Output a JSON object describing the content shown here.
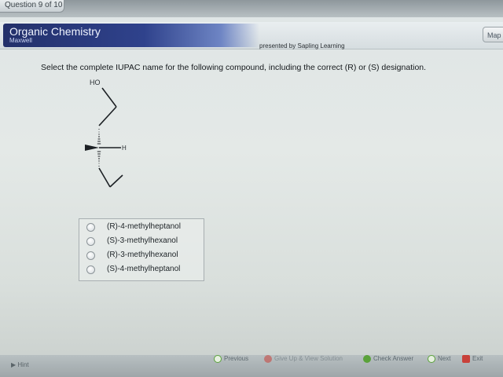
{
  "window": {
    "question_tab": "Question 9 of 10"
  },
  "brand": {
    "title": "Organic Chemistry",
    "subtitle": "Maxwell"
  },
  "header": {
    "presented_by": "presented by Sapling Learning",
    "map_label": "Map"
  },
  "question": {
    "text": "Select the complete IUPAC name for the following compound, including the correct (R) or (S) designation.",
    "molecule_labels": {
      "oh": "HO",
      "h": "H"
    }
  },
  "choices": [
    {
      "label": "(R)-4-methylheptanol",
      "selected": false
    },
    {
      "label": "(S)-3-methylhexanol",
      "selected": false
    },
    {
      "label": "(R)-3-methylhexanol",
      "selected": false
    },
    {
      "label": "(S)-4-methylheptanol",
      "selected": false
    }
  ],
  "footer": {
    "hint": "Hint",
    "previous": "Previous",
    "give_up": "Give Up & View Solution",
    "check_answer": "Check Answer",
    "next": "Next",
    "exit": "Exit"
  },
  "colors": {
    "brand_dark": "#23306a",
    "brand_light": "#6e85c4",
    "accent_green": "#5aa23a",
    "accent_red": "#c8413a"
  }
}
